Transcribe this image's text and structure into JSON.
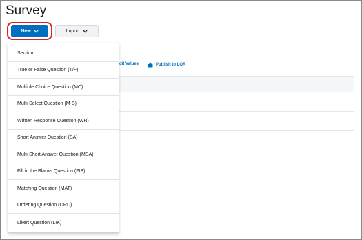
{
  "page": {
    "title": "Survey"
  },
  "toolbar": {
    "new_label": "New",
    "import_label": "Import",
    "edit_values_label": "dit Values",
    "publish_label": "Publish to LOR"
  },
  "new_menu": {
    "items": [
      {
        "label": "Section"
      },
      {
        "label": "True or False Question (T/F)"
      },
      {
        "label": "Multiple Choice Question (MC)"
      },
      {
        "label": "Multi-Select Question (M-S)"
      },
      {
        "label": "Written Response Question (WR)"
      },
      {
        "label": "Short Answer Question (SA)"
      },
      {
        "label": "Multi-Short Answer Question (MSA)"
      },
      {
        "label": "Fill in the Blanks Question (FIB)"
      },
      {
        "label": "Matching Question (MAT)"
      },
      {
        "label": "Ordering Question (ORD)"
      },
      {
        "label": "Likert Question (LIK)"
      }
    ]
  },
  "colors": {
    "primary_button": "#006fbf",
    "highlight_ring": "#e02020",
    "link": "#006fbf"
  },
  "icons": {
    "new_chevron": "chevron-down-icon",
    "import_chevron": "chevron-down-icon",
    "publish": "publish-icon"
  }
}
